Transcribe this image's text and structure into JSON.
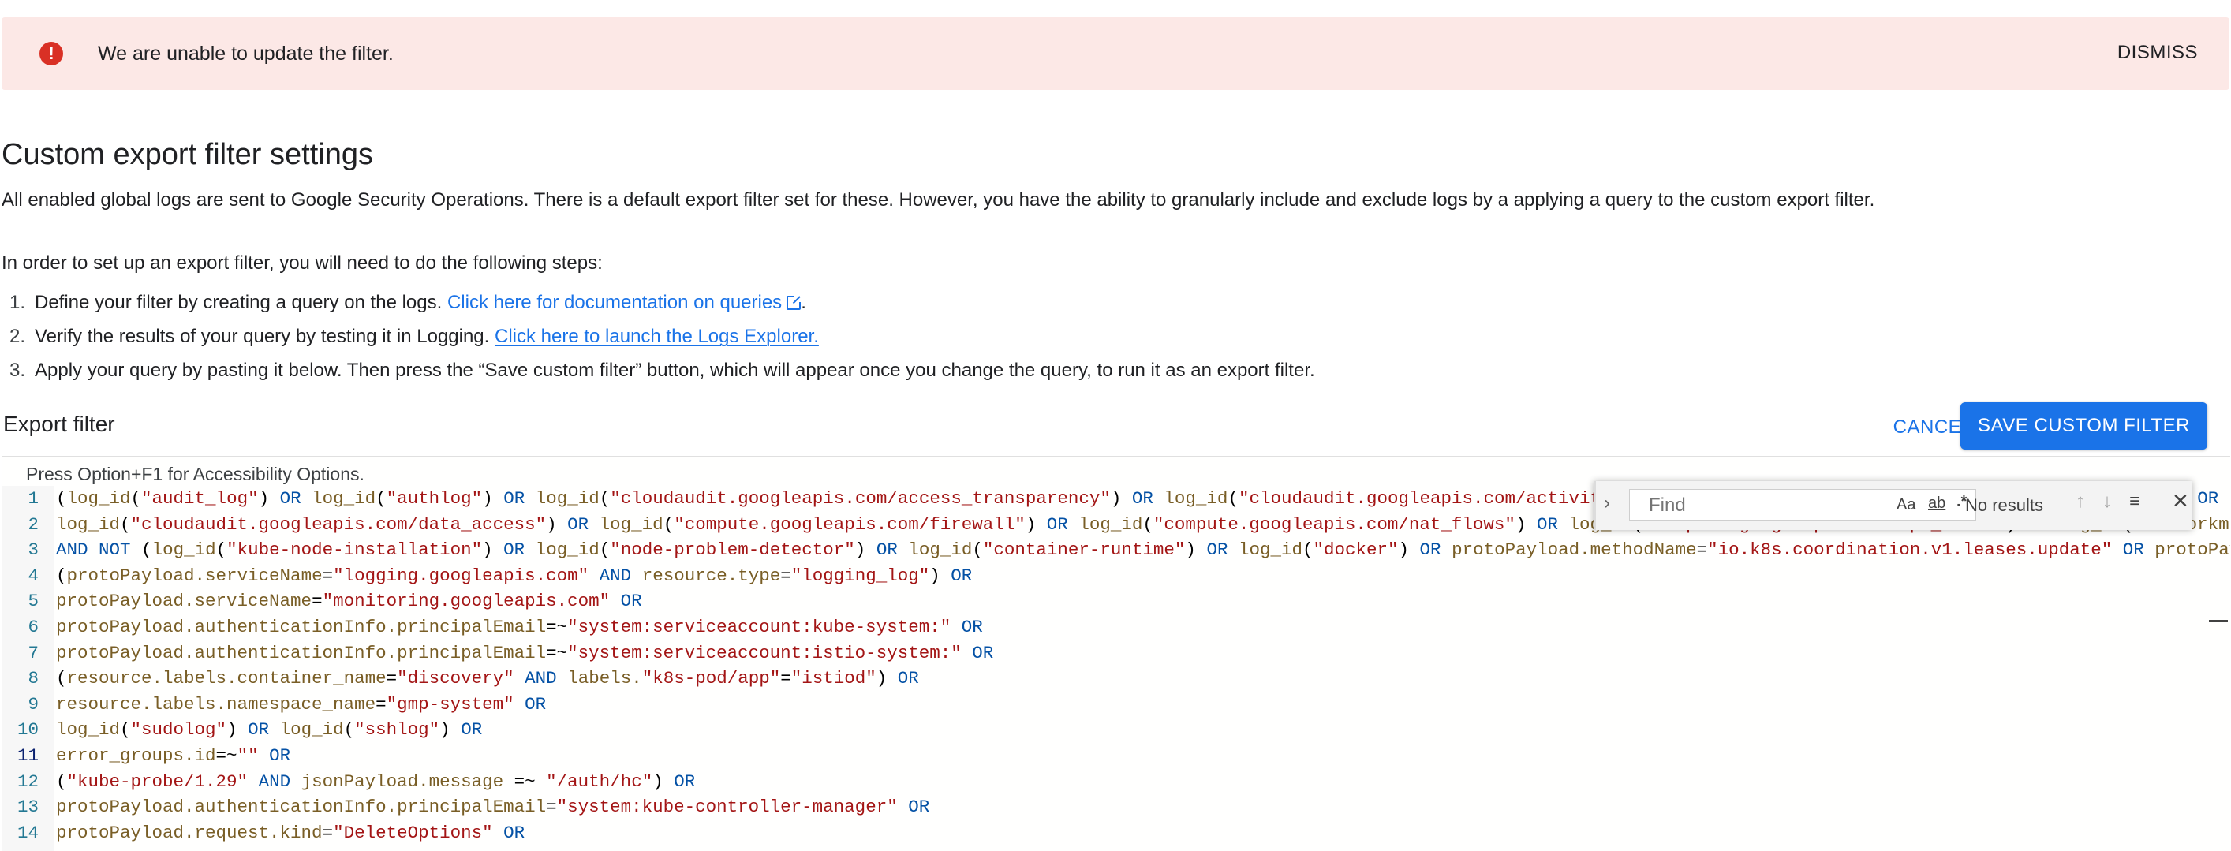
{
  "banner": {
    "message": "We are unable to update the filter.",
    "dismiss_label": "DISMISS",
    "icon": "error-icon",
    "background": "#fce8e6",
    "icon_color": "#d93025"
  },
  "section": {
    "title": "Custom export filter settings",
    "description": "All enabled global logs are sent to Google Security Operations. There is a default export filter set for these. However, you have the ability to granularly include and exclude logs by a applying a query to the custom export filter.",
    "steps_intro": "In order to set up an export filter, you will need to do the following steps:",
    "steps": [
      {
        "num": "1.",
        "text": "Define your filter by creating a query on the logs. ",
        "link": "Click here for documentation on queries",
        "suffix": "."
      },
      {
        "num": "2.",
        "text": "Verify the results of your query by testing it in Logging. ",
        "link": "Click here to launch the Logs Explorer.",
        "suffix": ""
      },
      {
        "num": "3.",
        "text": "Apply your query by pasting it below. Then press the “Save custom filter” button, which will appear once you change the query, to run it as an export filter.",
        "link": "",
        "suffix": ""
      }
    ]
  },
  "filter": {
    "title": "Export filter",
    "cancel_label": "CANCEL",
    "save_label": "SAVE CUSTOM FILTER",
    "accent": "#1a73e8"
  },
  "editor": {
    "a11y_hint": "Press Option+F1 for Accessibility Options.",
    "active_line": "11",
    "lines": [
      {
        "no": "1",
        "text": "(log_id(\"audit_log\") OR log_id(\"authlog\") OR log_id(\"cloudaudit.googleapis.com/access_transparency\") OR log_id(\"cloudaudit.googleapis.com/activity\") OR log_id(\"cloudaudit.googleapis.com/system_event\") OR log_id(\"clouda"
      },
      {
        "no": "2",
        "text": "log_id(\"cloudaudit.googleapis.com/data_access\") OR log_id(\"compute.googleapis.com/firewall\") OR log_id(\"compute.googleapis.com/nat_flows\") OR log_id(\"compute.googleapis.com/vpc_flows\") OR log_id(\"networkmanagement.googleapis.com"
      },
      {
        "no": "3",
        "text": "AND NOT (log_id(\"kube-node-installation\") OR log_id(\"node-problem-detector\") OR log_id(\"container-runtime\") OR log_id(\"docker\") OR protoPayload.methodName=\"io.k8s.coordination.v1.leases.update\" OR protoPayload.re"
      },
      {
        "no": "4",
        "text": "(protoPayload.serviceName=\"logging.googleapis.com\" AND resource.type=\"logging_log\") OR"
      },
      {
        "no": "5",
        "text": "protoPayload.serviceName=\"monitoring.googleapis.com\" OR"
      },
      {
        "no": "6",
        "text": "protoPayload.authenticationInfo.principalEmail=~\"system:serviceaccount:kube-system:\" OR"
      },
      {
        "no": "7",
        "text": "protoPayload.authenticationInfo.principalEmail=~\"system:serviceaccount:istio-system:\" OR"
      },
      {
        "no": "8",
        "text": "(resource.labels.container_name=\"discovery\" AND labels.\"k8s-pod/app\"=\"istiod\") OR"
      },
      {
        "no": "9",
        "text": "resource.labels.namespace_name=\"gmp-system\" OR"
      },
      {
        "no": "10",
        "text": "log_id(\"sudolog\") OR log_id(\"sshlog\") OR"
      },
      {
        "no": "11",
        "text": "error_groups.id=~\"\" OR"
      },
      {
        "no": "12",
        "text": "(\"kube-probe/1.29\" AND jsonPayload.message =~ \"/auth/hc\") OR"
      },
      {
        "no": "13",
        "text": "protoPayload.authenticationInfo.principalEmail=\"system:kube-controller-manager\" OR"
      },
      {
        "no": "14",
        "text": "protoPayload.request.kind=\"DeleteOptions\" OR"
      }
    ]
  },
  "find_widget": {
    "placeholder": "Find",
    "match_case": "Aa",
    "whole_word": "ab",
    "regex": ".*",
    "status": "No results",
    "prev": "↑",
    "next": "↓",
    "selection": "≡",
    "close": "✕"
  }
}
